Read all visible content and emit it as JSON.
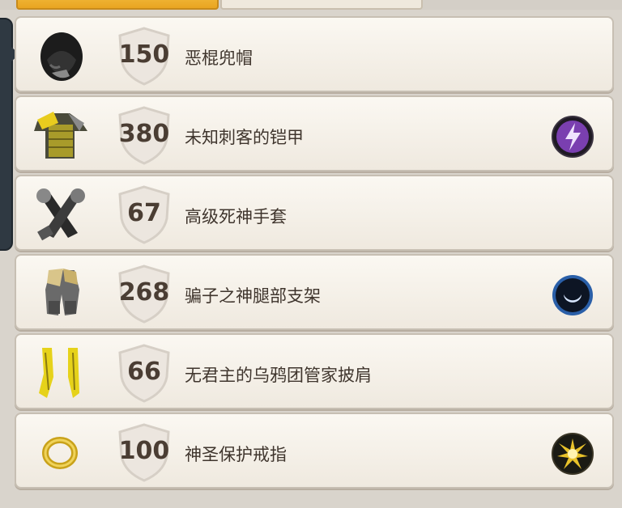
{
  "tabs": [
    {
      "label": "",
      "active": true
    },
    {
      "label": "",
      "active": false
    }
  ],
  "items": [
    {
      "score": "150",
      "name": "恶棍兜帽",
      "icon": "hood-icon",
      "badge": null
    },
    {
      "score": "380",
      "name": "未知刺客的铠甲",
      "icon": "chest-armor-icon",
      "badge": "lightning-rune-icon"
    },
    {
      "score": "67",
      "name": "高级死神手套",
      "icon": "gloves-icon",
      "badge": null
    },
    {
      "score": "268",
      "name": "骗子之神腿部支架",
      "icon": "leg-armor-icon",
      "badge": "crescent-moon-rune-icon"
    },
    {
      "score": "66",
      "name": "无君主的乌鸦团管家披肩",
      "icon": "cape-icon",
      "badge": null
    },
    {
      "score": "100",
      "name": "神圣保护戒指",
      "icon": "ring-icon",
      "badge": "sun-star-rune-icon"
    }
  ],
  "colors": {
    "tab_active": "#f2b93a",
    "row_bg": "#fbf8f2",
    "lightning_badge": "#7a3fb0",
    "moon_badge": "#2a5fa8",
    "sun_badge": "#e8c22a"
  }
}
